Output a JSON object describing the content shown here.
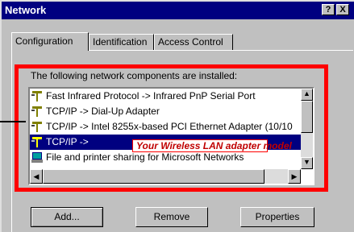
{
  "window": {
    "title": "Network",
    "help_glyph": "?",
    "close_glyph": "X"
  },
  "tabs": [
    {
      "label": "Configuration"
    },
    {
      "label": "Identification"
    },
    {
      "label": "Access Control"
    }
  ],
  "components": {
    "caption": "The following network components are installed:",
    "items": [
      {
        "icon": "network-protocol-icon",
        "label": "Fast Infrared Protocol -> Infrared PnP Serial Port"
      },
      {
        "icon": "network-protocol-icon",
        "label": "TCP/IP -> Dial-Up Adapter"
      },
      {
        "icon": "network-protocol-icon",
        "label": "TCP/IP -> Intel 8255x-based PCI Ethernet Adapter (10/10"
      },
      {
        "icon": "network-protocol-icon",
        "label": "TCP/IP ->",
        "selected": true
      },
      {
        "icon": "file-sharing-icon",
        "label": "File and printer sharing for Microsoft Networks"
      }
    ],
    "callout": "Your Wireless LAN adapter model"
  },
  "buttons": {
    "add": "Add...",
    "remove": "Remove",
    "properties": "Properties"
  },
  "colors": {
    "title_bar": "#000080",
    "highlight": "#ff0000",
    "selection": "#000080"
  }
}
